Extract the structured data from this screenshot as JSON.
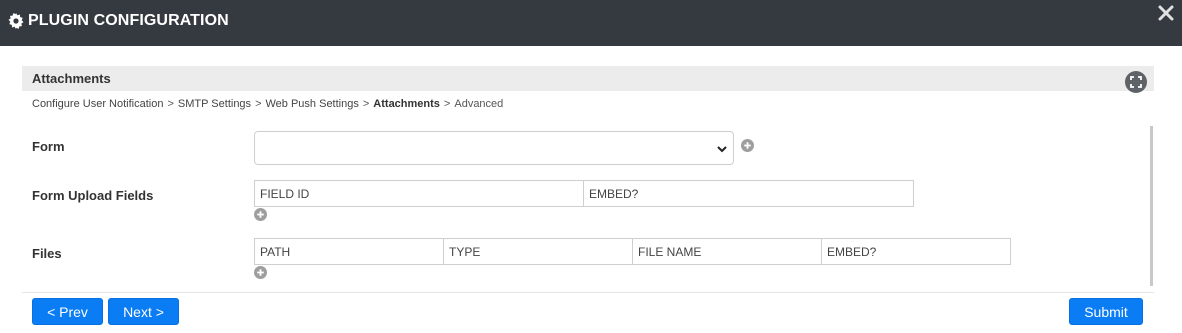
{
  "window": {
    "title": "PLUGIN CONFIGURATION",
    "title_icon": "gear-icon",
    "close_icon": "close-icon"
  },
  "section": {
    "title": "Attachments",
    "expand_icon": "expand-icon"
  },
  "breadcrumb": [
    {
      "label": "Configure User Notification",
      "state": "link"
    },
    {
      "label": "SMTP Settings",
      "state": "link"
    },
    {
      "label": "Web Push Settings",
      "state": "link"
    },
    {
      "label": "Attachments",
      "state": "current"
    },
    {
      "label": "Advanced",
      "state": "muted"
    }
  ],
  "breadcrumb_separator": ">",
  "form": {
    "form_label": "Form",
    "form_value": "",
    "upload_fields_label": "Form Upload Fields",
    "upload_fields_columns": [
      "FIELD ID",
      "EMBED?"
    ],
    "files_label": "Files",
    "files_columns": [
      "PATH",
      "TYPE",
      "FILE NAME",
      "EMBED?"
    ]
  },
  "footer": {
    "prev_label": "< Prev",
    "next_label": "Next >",
    "submit_label": "Submit"
  },
  "colors": {
    "titlebar_bg": "#343a40",
    "primary_button": "#0a7cf4",
    "section_header_bg": "#ececec"
  }
}
